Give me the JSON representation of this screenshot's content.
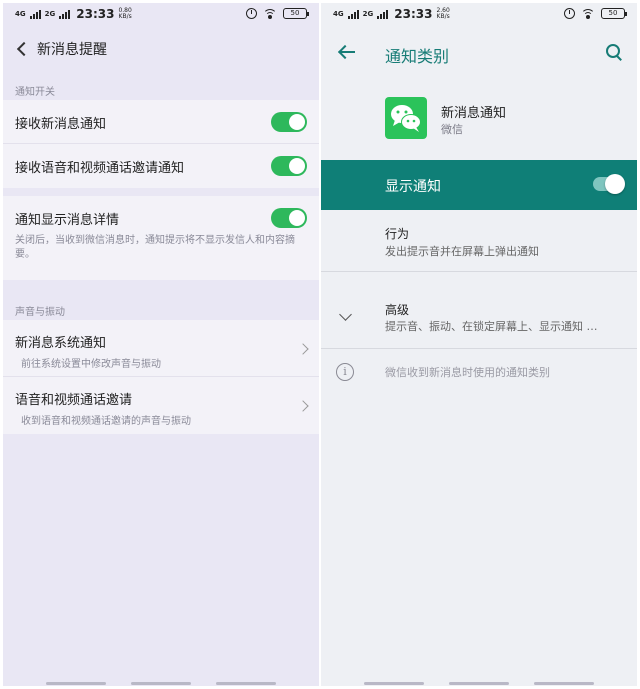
{
  "left": {
    "status": {
      "network1": "4G",
      "network2": "2G",
      "time": "23:33",
      "speed": "0.80",
      "speed_unit": "KB/s",
      "battery": "50"
    },
    "header": {
      "title": "新消息提醒"
    },
    "section_notify": "通知开关",
    "rows_notify": [
      {
        "title": "接收新消息通知",
        "on": true
      },
      {
        "title": "接收语音和视频通话邀请通知",
        "on": true
      }
    ],
    "detail_row": {
      "title": "通知显示消息详情",
      "on": true,
      "desc": "关闭后，当收到微信消息时，通知提示将不显示发信人和内容摘要。"
    },
    "section_sound": "声音与振动",
    "rows_sound": [
      {
        "title": "新消息系统通知",
        "sub": "前往系统设置中修改声音与振动"
      },
      {
        "title": "语音和视频通话邀请",
        "sub": "收到语音和视频通话邀请的声音与振动"
      }
    ]
  },
  "right": {
    "status": {
      "network1": "4G",
      "network2": "2G",
      "time": "23:33",
      "speed": "2.60",
      "speed_unit": "KB/s",
      "battery": "50"
    },
    "header": {
      "title": "通知类别"
    },
    "app": {
      "name": "新消息通知",
      "sub": "微信"
    },
    "show_notification": {
      "label": "显示通知",
      "on": true
    },
    "behavior": {
      "title": "行为",
      "sub": "发出提示音并在屏幕上弹出通知"
    },
    "advanced": {
      "title": "高级",
      "sub": "提示音、振动、在锁定屏幕上、显示通知 …"
    },
    "info": "微信收到新消息时使用的通知类别",
    "colors": {
      "accent": "#0f7f77",
      "toggle_green": "#2eb85c",
      "wechat_green": "#2bc35a"
    }
  }
}
